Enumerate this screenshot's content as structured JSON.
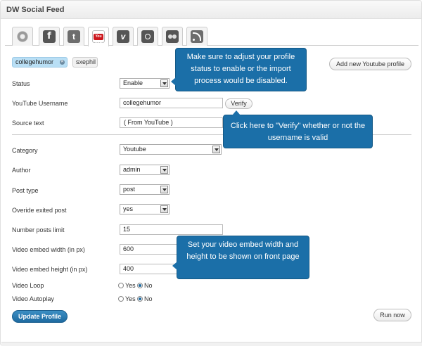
{
  "panel": {
    "title": "DW Social Feed"
  },
  "tabs": [
    {
      "icon": "gear-icon"
    },
    {
      "icon": "facebook-icon",
      "glyph": "f"
    },
    {
      "icon": "twitter-icon",
      "glyph": "t"
    },
    {
      "icon": "youtube-icon",
      "glyph": "You Tube"
    },
    {
      "icon": "vimeo-icon",
      "glyph": "v"
    },
    {
      "icon": "instagram-icon"
    },
    {
      "icon": "flickr-icon"
    },
    {
      "icon": "rss-icon"
    }
  ],
  "profiles": {
    "active": "collegehumor",
    "other": "sxephil"
  },
  "buttons": {
    "add_profile": "Add new Youtube profile",
    "verify": "Verify",
    "update": "Update Profile",
    "run": "Run now"
  },
  "form": {
    "status": {
      "label": "Status",
      "value": "Enable"
    },
    "username": {
      "label": "YouTube Username",
      "value": "collegehumor"
    },
    "source": {
      "label": "Source text",
      "value": "( From YouTube )"
    },
    "category": {
      "label": "Category",
      "value": "Youtube"
    },
    "author": {
      "label": "Author",
      "value": "admin"
    },
    "post_type": {
      "label": "Post type",
      "value": "post"
    },
    "override": {
      "label": "Overide exited post",
      "value": "yes"
    },
    "limit": {
      "label": "Number posts limit",
      "value": "15"
    },
    "width": {
      "label": "Video embed width (in px)",
      "value": "600"
    },
    "height": {
      "label": "Video embed height (in px)",
      "value": "400"
    },
    "loop": {
      "label": "Video Loop",
      "yes": "Yes",
      "no": "No"
    },
    "autoplay": {
      "label": "Video Autoplay",
      "yes": "Yes",
      "no": "No"
    }
  },
  "tooltips": {
    "status_tip": "Make sure to adjust your profile status to enable or the import process would be disabled.",
    "verify_tip": "Click here to \"Verify\" whether or not the username is valid",
    "embed_tip": "Set your video embed width and height to be shown on front page"
  },
  "colors": {
    "accent": "#1b6fa8",
    "tag_bg": "#b9dff5"
  }
}
